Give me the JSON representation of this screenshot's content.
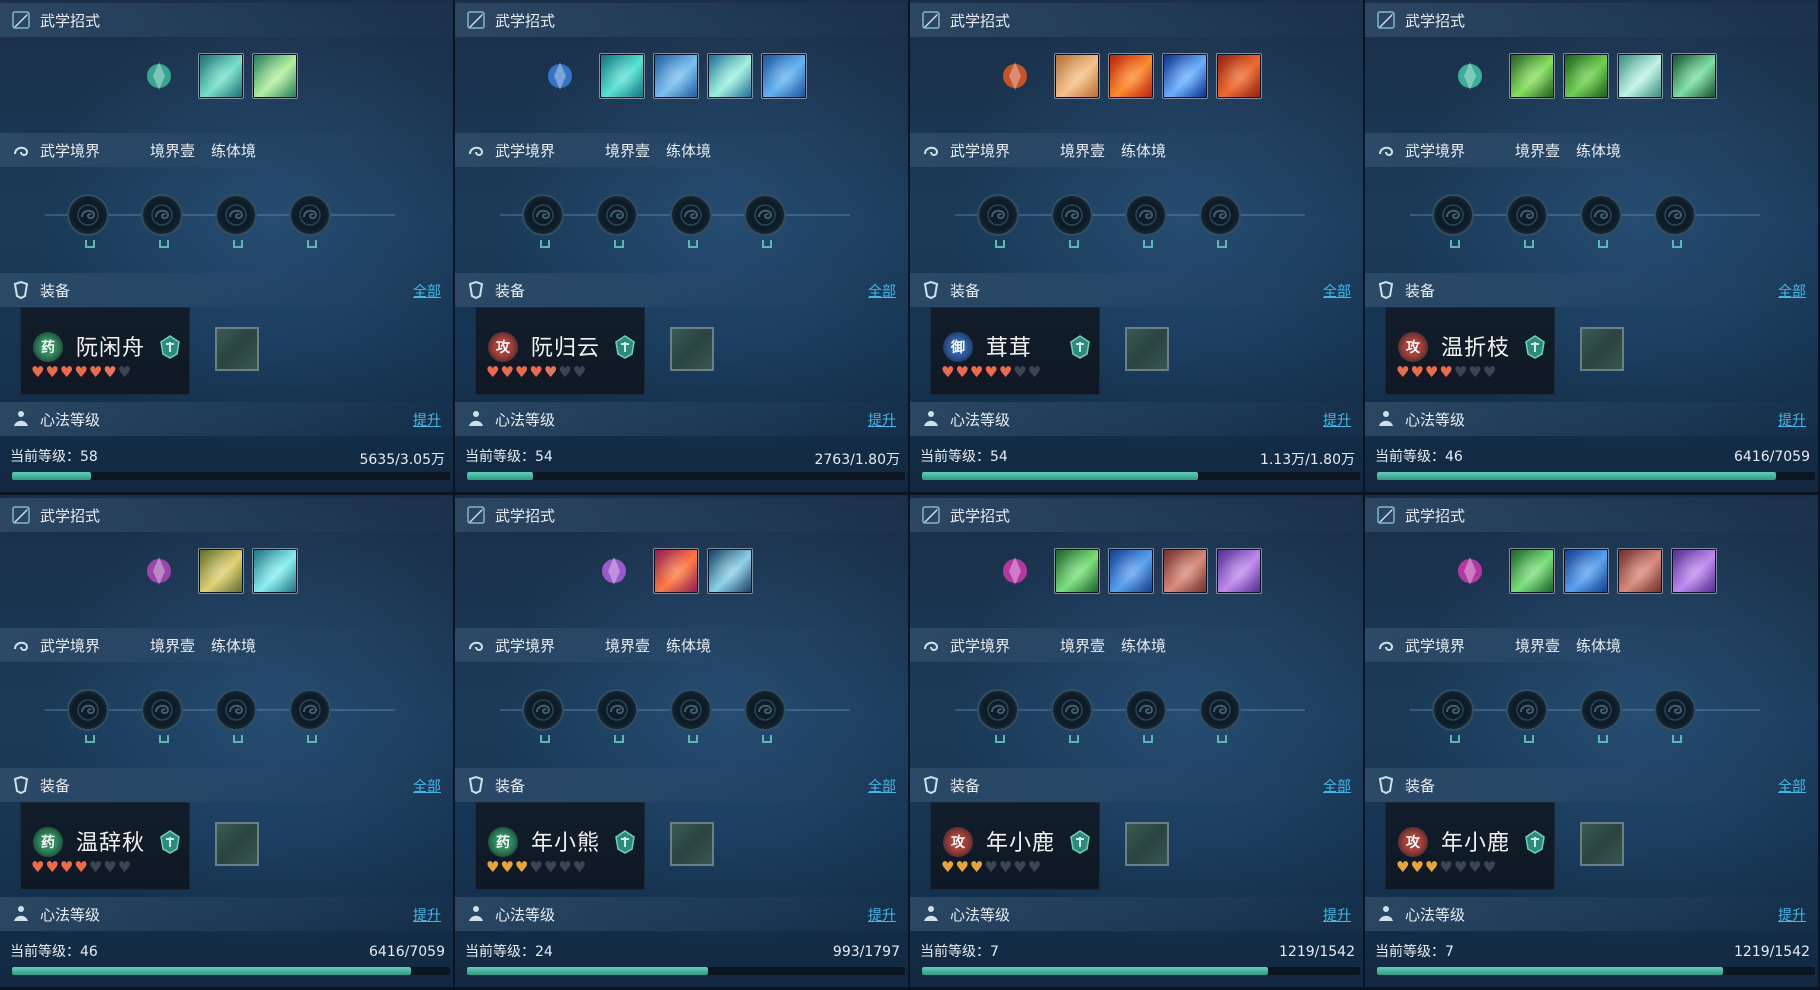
{
  "labels": {
    "skills": "武学招式",
    "realm": "武学境界",
    "realm_level": "境界壹",
    "realm_stage": "练体境",
    "equip": "装备",
    "equip_all": "全部",
    "xinfa": "心法等级",
    "upgrade": "提升",
    "current_level_prefix": "当前等级："
  },
  "panels": [
    {
      "name": "阮闲舟",
      "badge": "药",
      "badge_color": "#2f8a5c",
      "hearts": [
        "on",
        "on",
        "on",
        "on",
        "on",
        "half",
        "off"
      ],
      "level": "58",
      "progress": "5635/3.05万",
      "fill": 0.18,
      "skills": {
        "main": "#3fb89a",
        "icons": [
          [
            "#1d6a72",
            "#76e0c8"
          ],
          [
            "#1e7a5a",
            "#b5f0a0"
          ]
        ]
      }
    },
    {
      "name": "阮归云",
      "badge": "攻",
      "badge_color": "#a8403a",
      "hearts": [
        "on",
        "on",
        "on",
        "on",
        "half",
        "off",
        "off"
      ],
      "level": "54",
      "progress": "2763/1.80万",
      "fill": 0.15,
      "skills": {
        "main": "#3a7fd9",
        "icons": [
          [
            "#136e7a",
            "#58e3d4"
          ],
          [
            "#1f5a9a",
            "#7ac0f0"
          ],
          [
            "#1c6890",
            "#9ff2e0"
          ],
          [
            "#1a4f9a",
            "#63b4f3"
          ]
        ]
      }
    },
    {
      "name": "茸茸",
      "badge": "御",
      "badge_color": "#2f5fa8",
      "hearts": [
        "on",
        "on",
        "on",
        "on",
        "on",
        "off",
        "off"
      ],
      "level": "54",
      "progress": "1.13万/1.80万",
      "fill": 0.63,
      "skills": {
        "main": "#e05a1f",
        "icons": [
          [
            "#b56a2e",
            "#f5c28a"
          ],
          [
            "#b51e10",
            "#ff8a2a"
          ],
          [
            "#0c2a88",
            "#6ab0ff"
          ],
          [
            "#8a2010",
            "#f06a30"
          ]
        ]
      }
    },
    {
      "name": "温折枝",
      "badge": "攻",
      "badge_color": "#a8403a",
      "hearts": [
        "on",
        "on",
        "on",
        "on",
        "off",
        "off",
        "off"
      ],
      "level": "46",
      "progress": "6416/7059",
      "fill": 0.91,
      "skills": {
        "main": "#42c4a4",
        "icons": [
          [
            "#1e5a20",
            "#88e060"
          ],
          [
            "#1b5a1b",
            "#6ed050"
          ],
          [
            "#2f8a7a",
            "#c0f4e4"
          ],
          [
            "#184a30",
            "#7ae0a0"
          ]
        ]
      }
    },
    {
      "name": "温辞秋",
      "badge": "药",
      "badge_color": "#2f8a5c",
      "hearts": [
        "on",
        "on",
        "on",
        "on",
        "off",
        "off",
        "off"
      ],
      "level": "46",
      "progress": "6416/7059",
      "fill": 0.91,
      "skills": {
        "main": "#b04ab8",
        "icons": [
          [
            "#5a6a2a",
            "#e0d070"
          ],
          [
            "#1c6a7a",
            "#88f0f0"
          ]
        ]
      }
    },
    {
      "name": "年小熊",
      "badge": "药",
      "badge_color": "#2f8a5c",
      "hearts": [
        "gold",
        "gold",
        "gold",
        "off",
        "off",
        "off",
        "off"
      ],
      "level": "24",
      "progress": "993/1797",
      "fill": 0.55,
      "skills": {
        "main": "#b060e0",
        "icons": [
          [
            "#8a1a5a",
            "#ff7a40"
          ],
          [
            "#143a5a",
            "#8ad0e8"
          ]
        ]
      }
    },
    {
      "name": "年小鹿",
      "badge": "攻",
      "badge_color": "#a8403a",
      "hearts": [
        "gold",
        "gold",
        "gold",
        "off",
        "off",
        "off",
        "off"
      ],
      "level": "7",
      "progress": "1219/1542",
      "fill": 0.79,
      "skills": {
        "main": "#d03ab0",
        "icons": [
          [
            "#1a5a2a",
            "#7ae07a"
          ],
          [
            "#103a8a",
            "#5aa0f0"
          ],
          [
            "#6a2a2a",
            "#d88a7a"
          ],
          [
            "#4a2a8a",
            "#c08af0"
          ]
        ]
      }
    },
    {
      "name": "年小鹿",
      "badge": "攻",
      "badge_color": "#a8403a",
      "hearts": [
        "gold",
        "gold",
        "gold",
        "off",
        "off",
        "off",
        "off"
      ],
      "level": "7",
      "progress": "1219/1542",
      "fill": 0.79,
      "skills": {
        "main": "#d03ab0",
        "icons": [
          [
            "#1a5a2a",
            "#7ae07a"
          ],
          [
            "#103a8a",
            "#5aa0f0"
          ],
          [
            "#6a2a2a",
            "#d88a7a"
          ],
          [
            "#4a2a8a",
            "#c08af0"
          ]
        ]
      }
    }
  ]
}
